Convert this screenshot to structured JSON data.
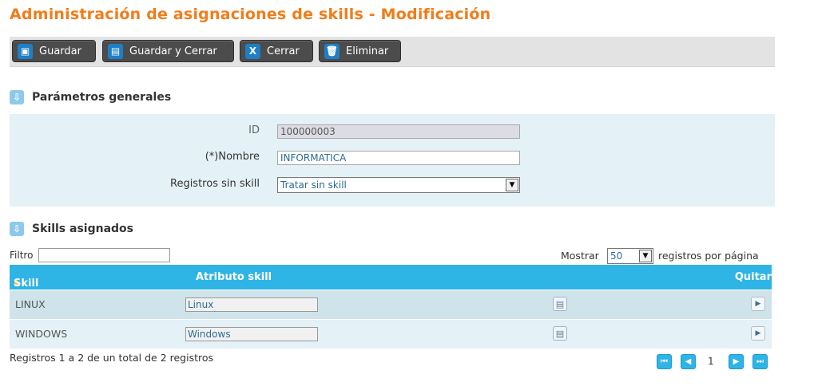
{
  "page": {
    "title": "Administración de asignaciones de skills - Modificación"
  },
  "toolbar": {
    "buttons": [
      {
        "label": "Guardar",
        "icon": "save-icon"
      },
      {
        "label": "Guardar y Cerrar",
        "icon": "save-close-icon"
      },
      {
        "label": "Cerrar",
        "icon": "close-icon"
      },
      {
        "label": "Eliminar",
        "icon": "trash-icon"
      }
    ]
  },
  "general": {
    "title": "Parámetros generales",
    "icon": "section-collapse-icon",
    "id_label": "ID",
    "id_value": "100000003",
    "nombre_label": "(*)Nombre",
    "nombre_value": "INFORMATICA",
    "registros_label": "Registros sin skill",
    "registros_value": "Tratar sin skill"
  },
  "skills": {
    "title": "Skills asignados",
    "icon": "section-collapse-icon",
    "filter_label": "Filtro",
    "filter_value": "",
    "show_label": "Mostrar",
    "page_size": "50",
    "per_page_label": "registros por página",
    "columns": {
      "skill": "Skill",
      "attribute": "Atributo skill",
      "remove": "Quitar"
    },
    "rows": [
      {
        "skill": "LINUX",
        "attribute": "Linux"
      },
      {
        "skill": "WINDOWS",
        "attribute": "Windows"
      }
    ],
    "summary": "Registros 1 a 2 de un total de 2 registros",
    "current_page": "1"
  },
  "colors": {
    "title": "#f07d1a",
    "toolbar_button": "#4c4c4c",
    "accent": "#2fb4e6",
    "panel_bg": "#e4f1f6"
  }
}
